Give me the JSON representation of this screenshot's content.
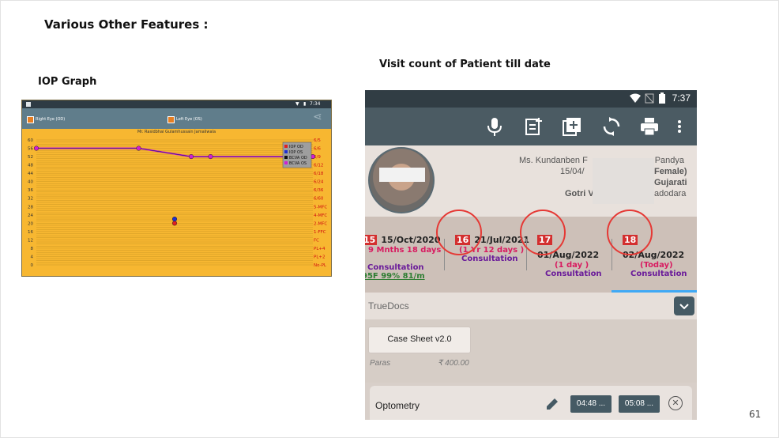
{
  "slide": {
    "heading": "Various Other Features :",
    "iop_heading": "IOP Graph",
    "visit_heading": "Visit count of Patient till date",
    "page_number": "61"
  },
  "iop_app": {
    "status_time": "7:34",
    "right_eye_label": "Right Eye (OD)",
    "left_eye_label": "Left Eye (OS)",
    "patient_name": "Mr. Rasidbhai Gulamhussain Jamaliwala",
    "icons": [
      "checkbox-icon",
      "share-icon"
    ]
  },
  "chart_data": {
    "type": "line",
    "y_tick_labels": [
      "60",
      "56",
      "52",
      "48",
      "44",
      "40",
      "36",
      "32",
      "28",
      "24",
      "20",
      "16",
      "12",
      "8",
      "4",
      "0"
    ],
    "ylim": [
      0,
      60
    ],
    "right_axis_labels": [
      "6/5",
      "6/6",
      "6/9",
      "6/12",
      "6/18",
      "6/24",
      "6/36",
      "6/60",
      "5-MFC",
      "4-MFC",
      "2-MFC",
      "1-FFC",
      "FC",
      "PL+4",
      "PL+2",
      "No-PL"
    ],
    "legend": [
      "IOP OD",
      "IOP OS",
      "BCVA OD",
      "BCVA OS"
    ],
    "legend_position": "top-right",
    "series": [
      {
        "name": "BCVA OS",
        "x": [
          0,
          0.37,
          0.56,
          0.63,
          1.0
        ],
        "values": [
          56,
          56,
          52,
          52,
          52
        ],
        "color": "#d21fd2"
      },
      {
        "name": "IOP OD",
        "x": [
          0.5
        ],
        "values": [
          20
        ],
        "color": "#e02020"
      },
      {
        "name": "IOP OS",
        "x": [
          0.5
        ],
        "values": [
          22
        ],
        "color": "#1f2fd2"
      }
    ]
  },
  "phone": {
    "status_time": "7:37",
    "toolbar_icons": [
      "microphone-icon",
      "note-add-icon",
      "add-box-icon",
      "sync-icon",
      "print-icon",
      "more-vert-icon"
    ],
    "patient": {
      "name_part1": "Ms. Kundanben F",
      "name_part2": "r Pandya",
      "dob_partial": "15/04/",
      "gender": "Female)",
      "language": "Gujarati",
      "area_left": "Gotri V",
      "area_right": "adodara"
    },
    "visits": [
      {
        "number": "15",
        "date": "15/Oct/2020",
        "duration": "( 9 Mnths 18 days )",
        "type": "Consultation",
        "extra": "95F 99% 81/m"
      },
      {
        "number": "16",
        "date": "21/Jul/2021",
        "duration": "(1 Yr 12 days )",
        "type": "Consultation"
      },
      {
        "number": "17",
        "date": "01/Aug/2022",
        "duration": "(1 day )",
        "type": "Consultation"
      },
      {
        "number": "18",
        "date": "02/Aug/2022",
        "duration": "(Today)",
        "type": "Consultation"
      }
    ],
    "truedocs_label": "TrueDocs",
    "case_sheet": {
      "title": "Case Sheet v2.0",
      "author": "Paras",
      "price": "₹ 400.00"
    },
    "optometry": {
      "label": "Optometry",
      "time_start": "04:48 ...",
      "time_end": "05:08 ..."
    }
  }
}
